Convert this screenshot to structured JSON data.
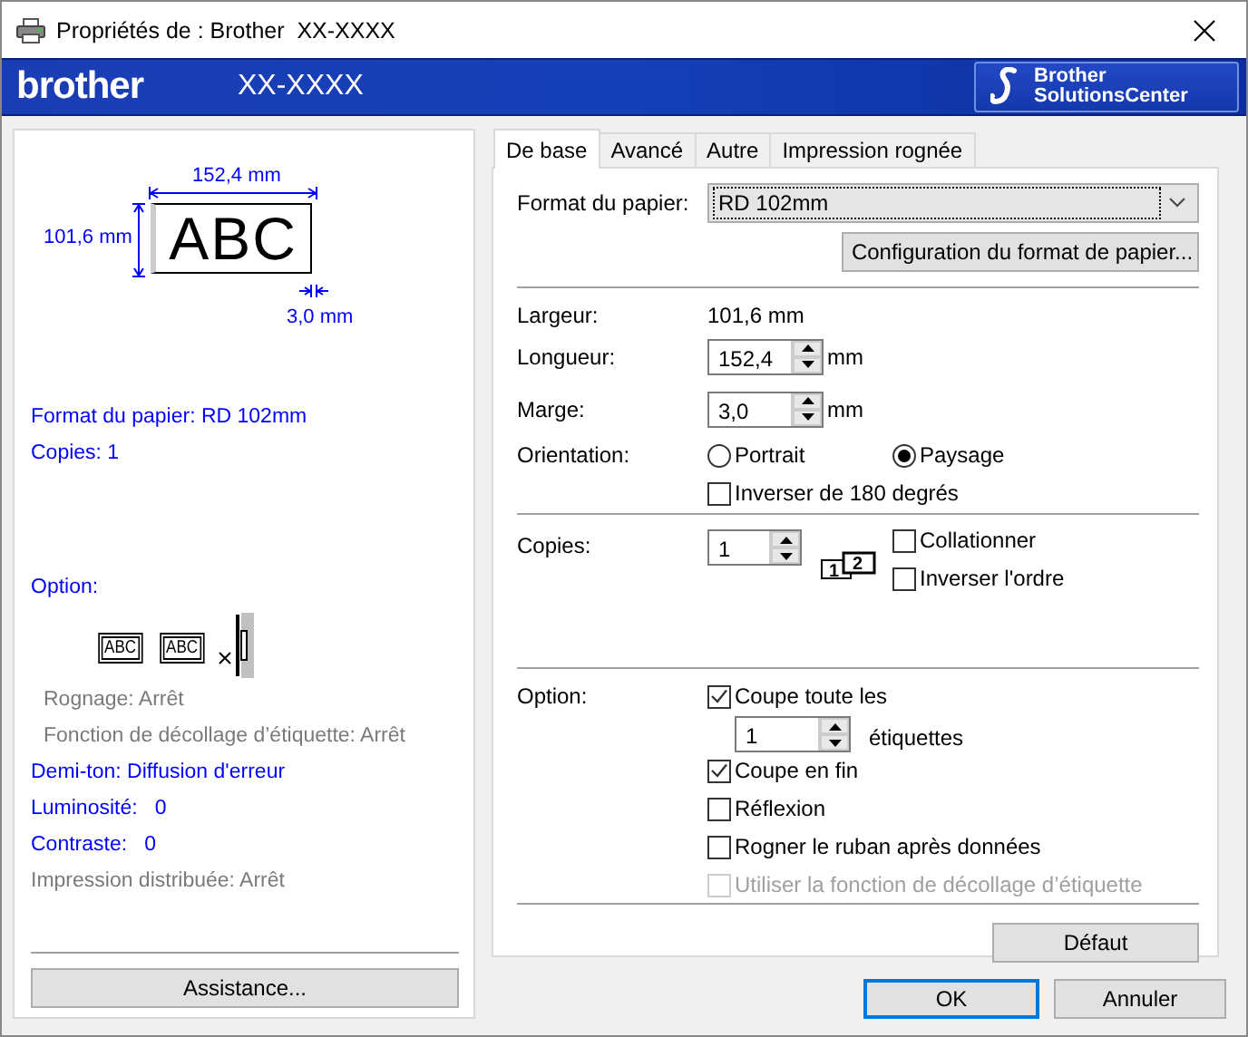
{
  "window": {
    "title": "Propriétés de : Brother  XX-XXXX"
  },
  "banner": {
    "logo": "brother",
    "model": "XX-XXXX",
    "solutions_button": [
      "Brother",
      "SolutionsCenter"
    ]
  },
  "preview": {
    "width_label": "152,4 mm",
    "height_label": "101,6 mm",
    "sample": "ABC",
    "margin_label": "3,0 mm"
  },
  "summary": [
    [
      {
        "kind": "setting",
        "text": "Format du papier: RD 102mm"
      },
      {
        "kind": "setting",
        "text": "Copies: 1"
      }
    ],
    [
      {
        "kind": "setting",
        "text": "Option:"
      },
      {
        "kind": "option_icons",
        "samples": [
          "ABC",
          "ABC"
        ]
      },
      {
        "kind": "detail",
        "text": "Rognage: Arrêt"
      },
      {
        "kind": "detail",
        "text": "Fonction de décollage d’étiquette: Arrêt"
      },
      {
        "kind": "setting",
        "text": "Demi-ton: Diffusion d'erreur"
      },
      {
        "kind": "setting",
        "text": "Luminosité:   0"
      },
      {
        "kind": "setting",
        "text": "Contraste:   0"
      },
      {
        "kind": "inactive",
        "text": "Impression distribuée: Arrêt"
      }
    ]
  ],
  "assistance_button": "Assistance...",
  "tabs": [
    {
      "label": "De base",
      "selected": true
    },
    {
      "label": "Avancé",
      "selected": false
    },
    {
      "label": "Autre",
      "selected": false
    },
    {
      "label": "Impression rognée",
      "selected": false
    }
  ],
  "basic": {
    "paper_format": {
      "label": "Format du papier:",
      "value": "RD 102mm"
    },
    "config_button": "Configuration du format de papier...",
    "width": {
      "label": "Largeur:",
      "value": "101,6 mm"
    },
    "length": {
      "label": "Longueur:",
      "value": "152,4",
      "unit": "mm"
    },
    "margin": {
      "label": "Marge:",
      "value": "3,0",
      "unit": "mm"
    },
    "orientation": {
      "label": "Orientation:",
      "options": [
        {
          "label": "Portrait",
          "selected": false
        },
        {
          "label": "Paysage",
          "selected": true
        }
      ]
    },
    "rotate": {
      "label": "Inverser de 180 degrés",
      "checked": false,
      "disabled": false
    },
    "copies": {
      "label": "Copies:",
      "value": "1",
      "collate_pages": [
        "1",
        "2"
      ],
      "checks": [
        {
          "label": "Collationner",
          "checked": false,
          "disabled": false
        },
        {
          "label": "Inverser l'ordre",
          "checked": false,
          "disabled": false
        }
      ]
    },
    "option": {
      "label": "Option:",
      "cut_every": {
        "label": "Coupe toute les",
        "checked": true,
        "disabled": false,
        "value": "1",
        "unit": "étiquettes"
      },
      "checks": [
        {
          "label": "Coupe en fin",
          "checked": true,
          "disabled": false
        },
        {
          "label": "Réflexion",
          "checked": false,
          "disabled": false
        },
        {
          "label": "Rogner le ruban après données",
          "checked": false,
          "disabled": false
        },
        {
          "label": "Utiliser la fonction de décollage d’étiquette",
          "checked": false,
          "disabled": true
        }
      ]
    },
    "default_button": "Défaut"
  },
  "footer": {
    "ok": "OK",
    "cancel": "Annuler"
  }
}
